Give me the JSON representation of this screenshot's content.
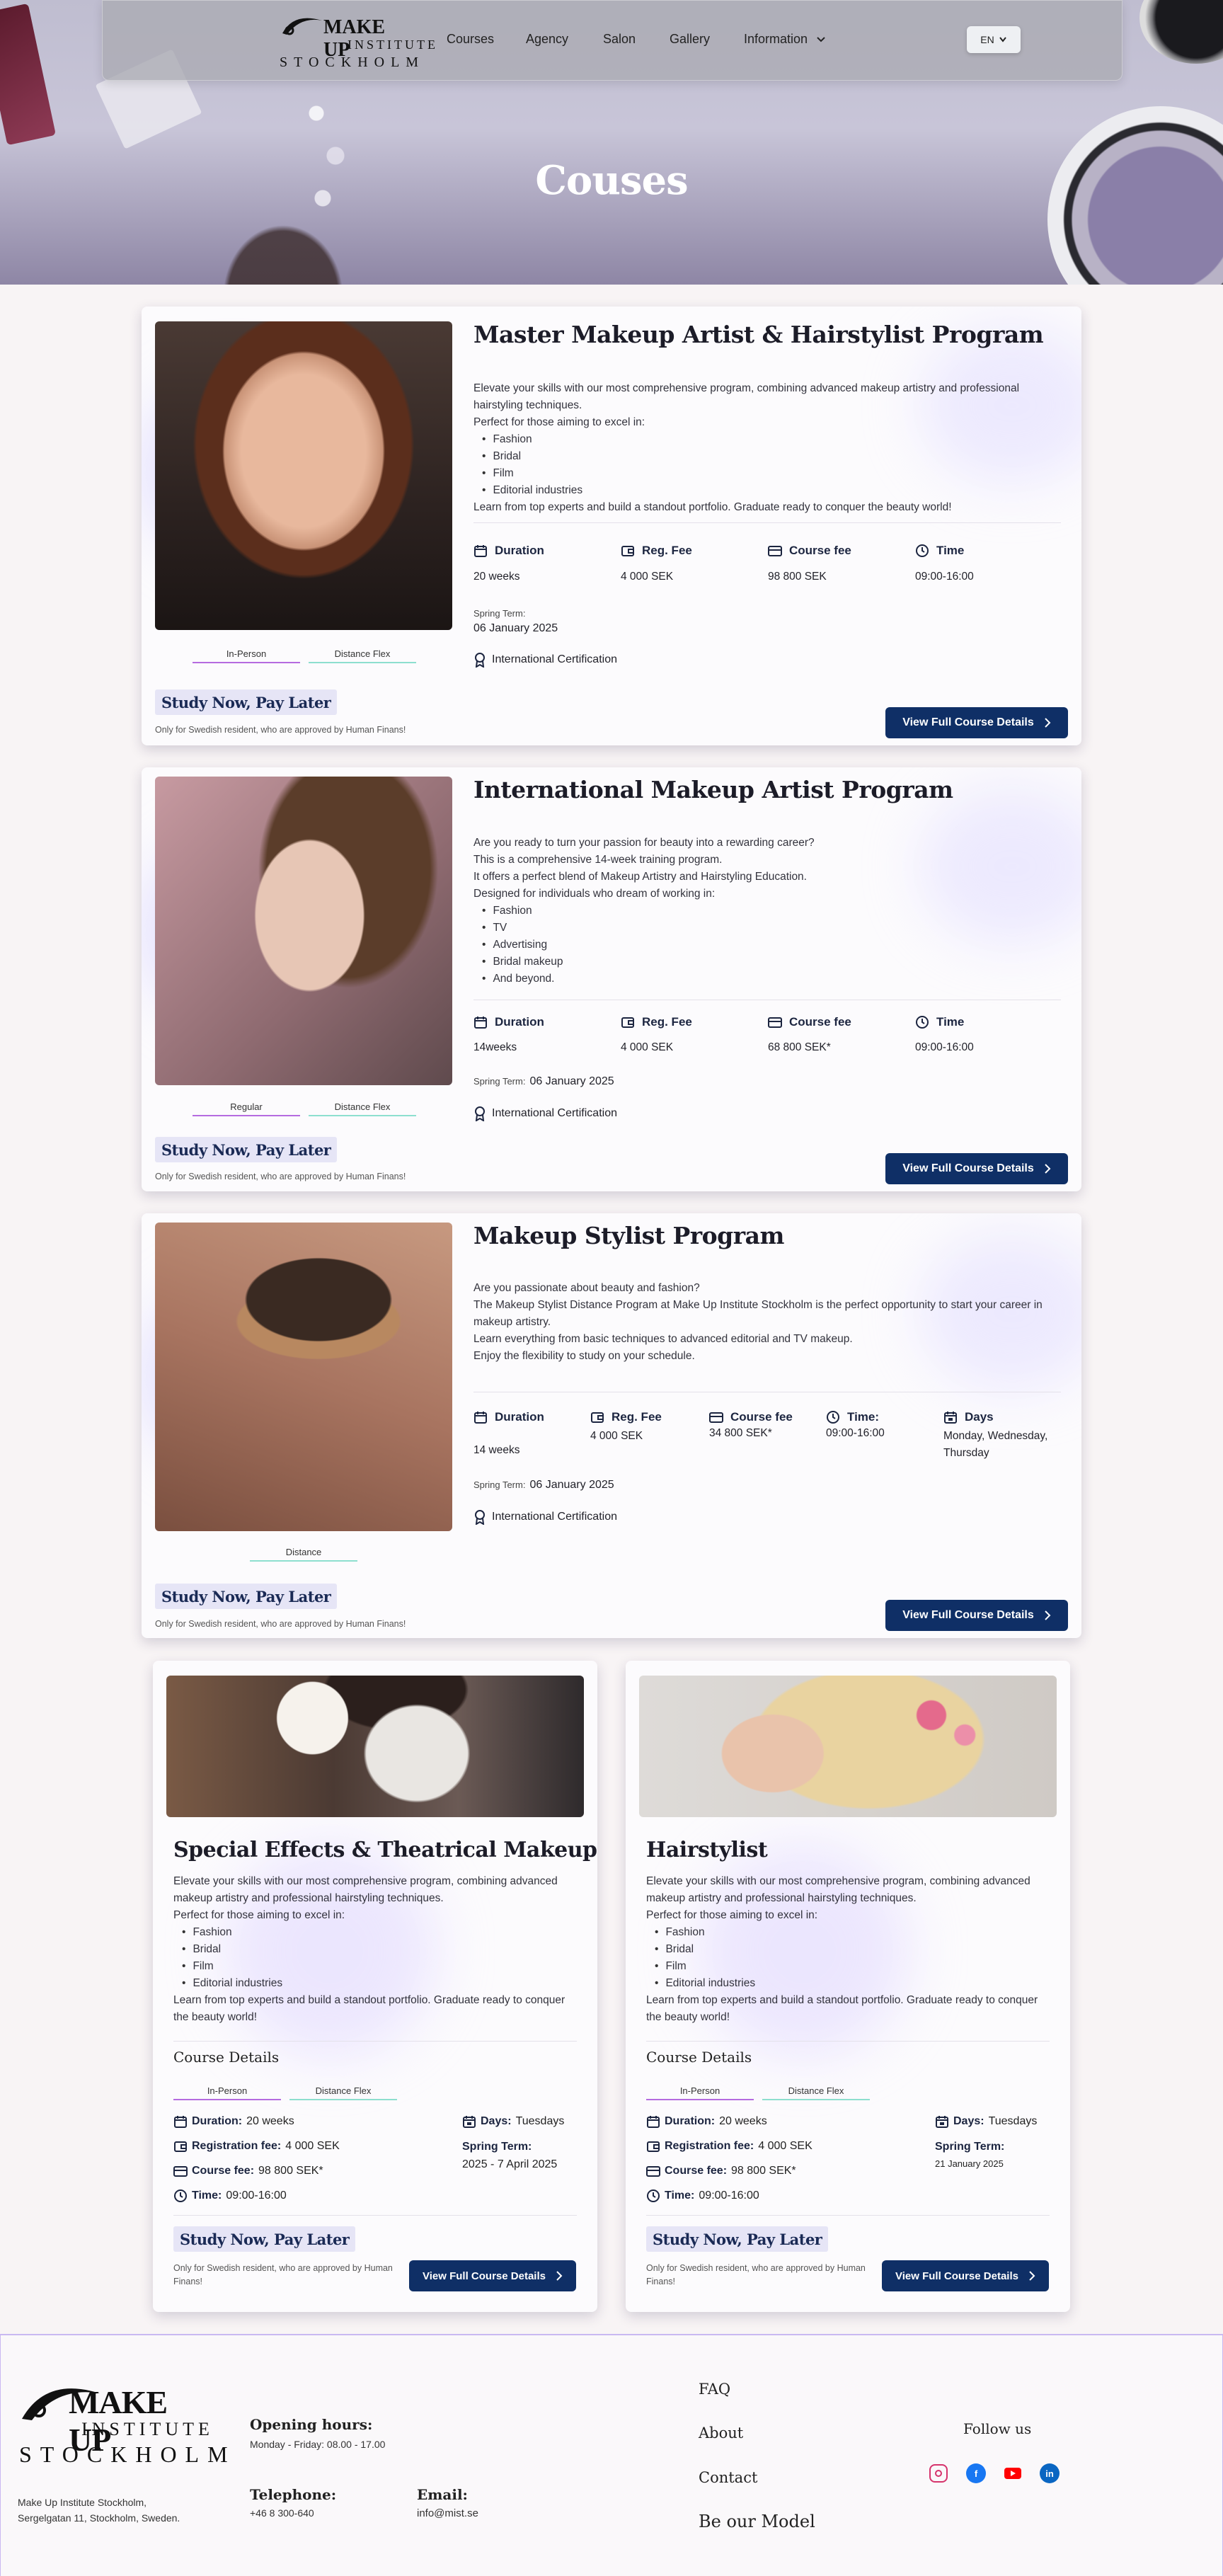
{
  "brand": {
    "line1": "MAKE UP",
    "line2": "INSTITUTE",
    "line3": "STOCKHOLM"
  },
  "nav": {
    "items": [
      "Courses",
      "Agency",
      "Salon",
      "Gallery",
      "Information"
    ],
    "lang": "EN"
  },
  "hero": {
    "title": "Couses"
  },
  "colors": {
    "primary_button": "#0f2f66",
    "tag_purple": "#b56be0",
    "tag_green": "#8ddfcf",
    "pay_later_bg": "#e6e5f6"
  },
  "courses": [
    {
      "title": "Master Makeup Artist &  Hairstylist Program",
      "description": [
        "Elevate your skills with our most comprehensive program, combining advanced makeup artistry and professional hairstyling techniques.",
        "Perfect for those aiming to excel in:"
      ],
      "bullets": [
        "Fashion",
        "Bridal",
        "Film",
        "Editorial industries"
      ],
      "closing": "Learn from top experts and build a standout portfolio. Graduate ready to conquer the beauty world!",
      "stats": [
        {
          "label": "Duration",
          "value": "20 weeks",
          "icon": "calendar-icon"
        },
        {
          "label": "Reg. Fee",
          "value": "4 000 SEK",
          "icon": "wallet-icon"
        },
        {
          "label": "Course fee",
          "value": "98 800 SEK",
          "icon": "card-icon"
        },
        {
          "label": "Time",
          "value": "09:00-16:00",
          "icon": "clock-icon"
        }
      ],
      "term_label": "Spring Term:",
      "term_value": "06 January 2025",
      "certification": "International Certification",
      "tags": [
        "In-Person",
        "Distance Flex"
      ],
      "pay_later": "Study Now, Pay Later",
      "fine_print": "Only for Swedish resident, who are approved by Human Finans!",
      "button": "View Full Course Details"
    },
    {
      "title": "International Makeup Artist Program",
      "description": [
        "Are you ready to turn your passion for beauty into a rewarding career?",
        "This is a comprehensive 14-week training program.",
        "It offers a perfect blend of Makeup Artistry and Hairstyling Education.",
        "Designed for individuals who dream of working in:"
      ],
      "bullets": [
        "Fashion",
        "TV",
        "Advertising",
        "Bridal makeup",
        "And beyond."
      ],
      "stats": [
        {
          "label": "Duration",
          "value": "14weeks",
          "icon": "calendar-icon"
        },
        {
          "label": "Reg. Fee",
          "value": "4 000 SEK",
          "icon": "wallet-icon"
        },
        {
          "label": "Course fee",
          "value": "68 800 SEK*",
          "icon": "card-icon"
        },
        {
          "label": "Time",
          "value": "09:00-16:00",
          "icon": "clock-icon"
        }
      ],
      "term_label": "Spring Term:",
      "term_value": "06 January 2025",
      "certification": "International Certification",
      "tags": [
        "Regular",
        "Distance Flex"
      ],
      "pay_later": "Study Now, Pay Later",
      "fine_print": "Only for Swedish resident, who are approved by Human Finans!",
      "button": "View Full Course Details"
    },
    {
      "title": "Makeup Stylist Program",
      "description": [
        "Are you passionate about beauty and fashion?",
        "The Makeup Stylist Distance Program at Make Up Institute Stockholm is the perfect opportunity to start your career in makeup artistry.",
        "Learn everything from basic techniques to advanced editorial and TV makeup.",
        "Enjoy the flexibility to study on your schedule."
      ],
      "stats": [
        {
          "label": "Duration",
          "value": "14 weeks",
          "icon": "calendar-icon"
        },
        {
          "label": "Reg. Fee",
          "value": "4 000 SEK",
          "icon": "wallet-icon"
        },
        {
          "label": "Course fee",
          "value": "34 800 SEK*",
          "icon": "card-icon"
        },
        {
          "label": "Time:",
          "value": "09:00-16:00",
          "icon": "clock-icon"
        },
        {
          "label": "Days",
          "value": "Monday,  Wednesday, Thursday",
          "icon": "calendar-days-icon"
        }
      ],
      "term_label": "Spring Term:",
      "term_value": "06 January 2025",
      "certification": "International Certification",
      "tags": [
        "Distance"
      ],
      "pay_later": "Study Now, Pay Later",
      "fine_print": "Only for Swedish resident, who are approved by Human Finans!",
      "button": "View Full Course Details"
    }
  ],
  "small_courses": [
    {
      "title": "Special Effects & Theatrical Makeup",
      "description": [
        "Elevate your skills with our most comprehensive program, combining advanced makeup artistry and professional hairstyling techniques.",
        "Perfect for those aiming to excel in:"
      ],
      "bullets": [
        "Fashion",
        "Bridal",
        "Film",
        "Editorial industries"
      ],
      "closing": "Learn from top experts and build a standout portfolio. Graduate ready to conquer the beauty world!",
      "details_heading": "Course Details",
      "tags": [
        "In-Person",
        "Distance Flex"
      ],
      "duration_label": "Duration:",
      "duration": "20 weeks",
      "reg_label": "Registration fee:",
      "reg": "4 000 SEK",
      "fee_label": "Course fee:",
      "fee": "98 800 SEK*",
      "time_label": "Time:",
      "time": "09:00-16:00",
      "days_label": "Days:",
      "days": "Tuesdays",
      "term_label": "Spring Term:",
      "term": "2025 - 7 April 2025",
      "pay_later": "Study Now, Pay Later",
      "fine_print": "Only for Swedish resident, who are approved by Human Finans!",
      "button": "View Full Course Details"
    },
    {
      "title": "Hairstylist",
      "description": [
        "Elevate your skills with our most comprehensive program, combining advanced makeup artistry and professional hairstyling techniques.",
        "Perfect for those aiming to excel in:"
      ],
      "bullets": [
        "Fashion",
        "Bridal",
        "Film",
        "Editorial industries"
      ],
      "closing": "Learn from top experts and build a standout portfolio. Graduate ready to conquer the beauty world!",
      "details_heading": "Course Details",
      "tags": [
        "In-Person",
        "Distance Flex"
      ],
      "duration_label": "Duration:",
      "duration": "20 weeks",
      "reg_label": "Registration fee:",
      "reg": "4 000 SEK",
      "fee_label": "Course fee:",
      "fee": "98 800 SEK*",
      "time_label": "Time:",
      "time": "09:00-16:00",
      "days_label": "Days:",
      "days": "Tuesdays",
      "term_label": "Spring Term:",
      "term": "21 January 2025",
      "pay_later": "Study Now, Pay Later",
      "fine_print": "Only for Swedish resident, who are approved by Human Finans!",
      "button": "View Full Course Details"
    }
  ],
  "footer": {
    "address_line1": "Make Up Institute Stockholm,",
    "address_line2": "Sergelgatan 11, Stockholm, Sweden.",
    "hours_heading": "Opening hours:",
    "hours": "Monday - Friday: 08.00  - 17.00",
    "phone_heading": "Telephone:",
    "phone": "+46 8 300-640",
    "email_heading": "Email:",
    "email": "info@mist.se",
    "links": [
      "FAQ",
      "About",
      "Contact",
      "Be our Model"
    ],
    "follow": "Follow us",
    "social": [
      "instagram-icon",
      "facebook-icon",
      "youtube-icon",
      "linkedin-icon"
    ]
  }
}
